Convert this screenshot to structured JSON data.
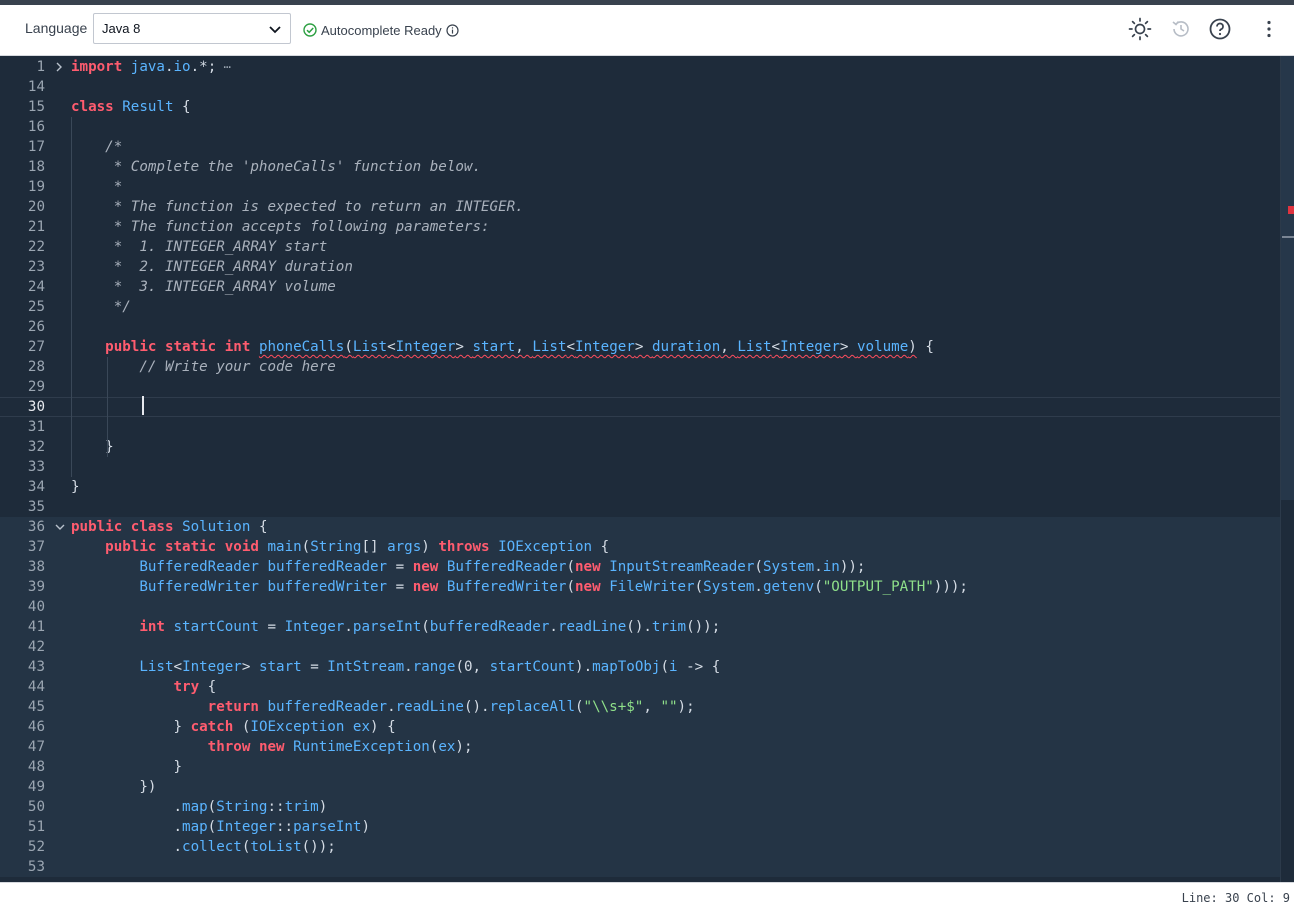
{
  "toolbar": {
    "language_label": "Language",
    "language_value": "Java 8",
    "autocomplete_status": "Autocomplete Ready",
    "icons": [
      "chevron-down-icon",
      "check-circle-icon",
      "info-icon",
      "sun-icon",
      "history-icon",
      "help-icon",
      "more-vertical-icon"
    ]
  },
  "editor": {
    "lines": [
      {
        "n": "1",
        "fold": "collapsed",
        "tokens": [
          [
            "kw",
            "import"
          ],
          [
            "pl",
            " "
          ],
          [
            "ty",
            "java"
          ],
          [
            "pl",
            "."
          ],
          [
            "ty",
            "io"
          ],
          [
            "pl",
            ".*;"
          ],
          [
            "ell",
            " ⋯"
          ]
        ]
      },
      {
        "n": "14",
        "tokens": []
      },
      {
        "n": "15",
        "tokens": [
          [
            "kw",
            "class"
          ],
          [
            "pl",
            " "
          ],
          [
            "ty",
            "Result"
          ],
          [
            "pl",
            " {"
          ]
        ]
      },
      {
        "n": "16",
        "tokens": []
      },
      {
        "n": "17",
        "tokens": [
          [
            "cm",
            "    /*"
          ]
        ]
      },
      {
        "n": "18",
        "tokens": [
          [
            "cm",
            "     * Complete the 'phoneCalls' function below."
          ]
        ]
      },
      {
        "n": "19",
        "tokens": [
          [
            "cm",
            "     *"
          ]
        ]
      },
      {
        "n": "20",
        "tokens": [
          [
            "cm",
            "     * The function is expected to return an INTEGER."
          ]
        ]
      },
      {
        "n": "21",
        "tokens": [
          [
            "cm",
            "     * The function accepts following parameters:"
          ]
        ]
      },
      {
        "n": "22",
        "tokens": [
          [
            "cm",
            "     *  1. INTEGER_ARRAY start"
          ]
        ]
      },
      {
        "n": "23",
        "tokens": [
          [
            "cm",
            "     *  2. INTEGER_ARRAY duration"
          ]
        ]
      },
      {
        "n": "24",
        "tokens": [
          [
            "cm",
            "     *  3. INTEGER_ARRAY volume"
          ]
        ]
      },
      {
        "n": "25",
        "tokens": [
          [
            "cm",
            "     */"
          ]
        ]
      },
      {
        "n": "26",
        "tokens": []
      },
      {
        "n": "27",
        "tokens": [
          [
            "pl",
            "    "
          ],
          [
            "kw",
            "public"
          ],
          [
            "pl",
            " "
          ],
          [
            "kw",
            "static"
          ],
          [
            "pl",
            " "
          ],
          [
            "kw",
            "int"
          ],
          [
            "pl",
            " "
          ],
          [
            "fnsq",
            "phoneCalls"
          ],
          [
            "plsq",
            "("
          ],
          [
            "tysq",
            "List"
          ],
          [
            "plsq",
            "<"
          ],
          [
            "tysq",
            "Integer"
          ],
          [
            "plsq",
            "> "
          ],
          [
            "tysq",
            "start"
          ],
          [
            "plsq",
            ", "
          ],
          [
            "tysq",
            "List"
          ],
          [
            "plsq",
            "<"
          ],
          [
            "tysq",
            "Integer"
          ],
          [
            "plsq",
            "> "
          ],
          [
            "tysq",
            "duration"
          ],
          [
            "plsq",
            ", "
          ],
          [
            "tysq",
            "List"
          ],
          [
            "plsq",
            "<"
          ],
          [
            "tysq",
            "Integer"
          ],
          [
            "plsq",
            "> "
          ],
          [
            "tysq",
            "volume"
          ],
          [
            "plsq",
            ")"
          ],
          [
            "pl",
            " {"
          ]
        ]
      },
      {
        "n": "28",
        "tokens": [
          [
            "cm",
            "        // Write your code here"
          ]
        ]
      },
      {
        "n": "29",
        "tokens": []
      },
      {
        "n": "30",
        "active": true,
        "tokens": []
      },
      {
        "n": "31",
        "tokens": []
      },
      {
        "n": "32",
        "tokens": [
          [
            "pl",
            "    }"
          ]
        ]
      },
      {
        "n": "33",
        "tokens": []
      },
      {
        "n": "34",
        "tokens": [
          [
            "pl",
            "}"
          ]
        ]
      },
      {
        "n": "35",
        "tokens": []
      },
      {
        "n": "36",
        "fold": "expanded",
        "hl": true,
        "tokens": [
          [
            "kw",
            "public"
          ],
          [
            "pl",
            " "
          ],
          [
            "kw",
            "class"
          ],
          [
            "pl",
            " "
          ],
          [
            "ty",
            "Solution"
          ],
          [
            "pl",
            " {"
          ]
        ]
      },
      {
        "n": "37",
        "hl": true,
        "tokens": [
          [
            "pl",
            "    "
          ],
          [
            "kw",
            "public"
          ],
          [
            "pl",
            " "
          ],
          [
            "kw",
            "static"
          ],
          [
            "pl",
            " "
          ],
          [
            "kw",
            "void"
          ],
          [
            "pl",
            " "
          ],
          [
            "fn",
            "main"
          ],
          [
            "pl",
            "("
          ],
          [
            "ty",
            "String"
          ],
          [
            "pl",
            "[] "
          ],
          [
            "ty",
            "args"
          ],
          [
            "pl",
            ") "
          ],
          [
            "kw",
            "throws"
          ],
          [
            "pl",
            " "
          ],
          [
            "ty",
            "IOException"
          ],
          [
            "pl",
            " {"
          ]
        ]
      },
      {
        "n": "38",
        "hl": true,
        "tokens": [
          [
            "pl",
            "        "
          ],
          [
            "ty",
            "BufferedReader"
          ],
          [
            "pl",
            " "
          ],
          [
            "ty",
            "bufferedReader"
          ],
          [
            "pl",
            " = "
          ],
          [
            "kw",
            "new"
          ],
          [
            "pl",
            " "
          ],
          [
            "ty",
            "BufferedReader"
          ],
          [
            "pl",
            "("
          ],
          [
            "kw",
            "new"
          ],
          [
            "pl",
            " "
          ],
          [
            "ty",
            "InputStreamReader"
          ],
          [
            "pl",
            "("
          ],
          [
            "ty",
            "System"
          ],
          [
            "pl",
            "."
          ],
          [
            "ty",
            "in"
          ],
          [
            "pl",
            "));"
          ]
        ]
      },
      {
        "n": "39",
        "hl": true,
        "tokens": [
          [
            "pl",
            "        "
          ],
          [
            "ty",
            "BufferedWriter"
          ],
          [
            "pl",
            " "
          ],
          [
            "ty",
            "bufferedWriter"
          ],
          [
            "pl",
            " = "
          ],
          [
            "kw",
            "new"
          ],
          [
            "pl",
            " "
          ],
          [
            "ty",
            "BufferedWriter"
          ],
          [
            "pl",
            "("
          ],
          [
            "kw",
            "new"
          ],
          [
            "pl",
            " "
          ],
          [
            "ty",
            "FileWriter"
          ],
          [
            "pl",
            "("
          ],
          [
            "ty",
            "System"
          ],
          [
            "pl",
            "."
          ],
          [
            "fn",
            "getenv"
          ],
          [
            "pl",
            "("
          ],
          [
            "st",
            "\"OUTPUT_PATH\""
          ],
          [
            "pl",
            ")));"
          ]
        ]
      },
      {
        "n": "40",
        "hl": true,
        "tokens": []
      },
      {
        "n": "41",
        "hl": true,
        "tokens": [
          [
            "pl",
            "        "
          ],
          [
            "kw",
            "int"
          ],
          [
            "pl",
            " "
          ],
          [
            "ty",
            "startCount"
          ],
          [
            "pl",
            " = "
          ],
          [
            "ty",
            "Integer"
          ],
          [
            "pl",
            "."
          ],
          [
            "fn",
            "parseInt"
          ],
          [
            "pl",
            "("
          ],
          [
            "ty",
            "bufferedReader"
          ],
          [
            "pl",
            "."
          ],
          [
            "fn",
            "readLine"
          ],
          [
            "pl",
            "()."
          ],
          [
            "fn",
            "trim"
          ],
          [
            "pl",
            "());"
          ]
        ]
      },
      {
        "n": "42",
        "hl": true,
        "tokens": []
      },
      {
        "n": "43",
        "hl": true,
        "tokens": [
          [
            "pl",
            "        "
          ],
          [
            "ty",
            "List"
          ],
          [
            "pl",
            "<"
          ],
          [
            "ty",
            "Integer"
          ],
          [
            "pl",
            "> "
          ],
          [
            "ty",
            "start"
          ],
          [
            "pl",
            " = "
          ],
          [
            "ty",
            "IntStream"
          ],
          [
            "pl",
            "."
          ],
          [
            "fn",
            "range"
          ],
          [
            "pl",
            "(0, "
          ],
          [
            "ty",
            "startCount"
          ],
          [
            "pl",
            ")."
          ],
          [
            "fn",
            "mapToObj"
          ],
          [
            "pl",
            "("
          ],
          [
            "ty",
            "i"
          ],
          [
            "pl",
            " -> {"
          ]
        ]
      },
      {
        "n": "44",
        "hl": true,
        "tokens": [
          [
            "pl",
            "            "
          ],
          [
            "kw",
            "try"
          ],
          [
            "pl",
            " {"
          ]
        ]
      },
      {
        "n": "45",
        "hl": true,
        "tokens": [
          [
            "pl",
            "                "
          ],
          [
            "kw",
            "return"
          ],
          [
            "pl",
            " "
          ],
          [
            "ty",
            "bufferedReader"
          ],
          [
            "pl",
            "."
          ],
          [
            "fn",
            "readLine"
          ],
          [
            "pl",
            "()."
          ],
          [
            "fn",
            "replaceAll"
          ],
          [
            "pl",
            "("
          ],
          [
            "st",
            "\"\\\\s+$\""
          ],
          [
            "pl",
            ", "
          ],
          [
            "st",
            "\"\""
          ],
          [
            "pl",
            ");"
          ]
        ]
      },
      {
        "n": "46",
        "hl": true,
        "tokens": [
          [
            "pl",
            "            } "
          ],
          [
            "kw",
            "catch"
          ],
          [
            "pl",
            " ("
          ],
          [
            "ty",
            "IOException"
          ],
          [
            "pl",
            " "
          ],
          [
            "ty",
            "ex"
          ],
          [
            "pl",
            ") {"
          ]
        ]
      },
      {
        "n": "47",
        "hl": true,
        "tokens": [
          [
            "pl",
            "                "
          ],
          [
            "kw",
            "throw"
          ],
          [
            "pl",
            " "
          ],
          [
            "kw",
            "new"
          ],
          [
            "pl",
            " "
          ],
          [
            "ty",
            "RuntimeException"
          ],
          [
            "pl",
            "("
          ],
          [
            "ty",
            "ex"
          ],
          [
            "pl",
            ");"
          ]
        ]
      },
      {
        "n": "48",
        "hl": true,
        "tokens": [
          [
            "pl",
            "            }"
          ]
        ]
      },
      {
        "n": "49",
        "hl": true,
        "tokens": [
          [
            "pl",
            "        })"
          ]
        ]
      },
      {
        "n": "50",
        "hl": true,
        "tokens": [
          [
            "pl",
            "            ."
          ],
          [
            "fn",
            "map"
          ],
          [
            "pl",
            "("
          ],
          [
            "ty",
            "String"
          ],
          [
            "pl",
            "::"
          ],
          [
            "fn",
            "trim"
          ],
          [
            "pl",
            ")"
          ]
        ]
      },
      {
        "n": "51",
        "hl": true,
        "tokens": [
          [
            "pl",
            "            ."
          ],
          [
            "fn",
            "map"
          ],
          [
            "pl",
            "("
          ],
          [
            "ty",
            "Integer"
          ],
          [
            "pl",
            "::"
          ],
          [
            "fn",
            "parseInt"
          ],
          [
            "pl",
            ")"
          ]
        ]
      },
      {
        "n": "52",
        "hl": true,
        "tokens": [
          [
            "pl",
            "            ."
          ],
          [
            "fn",
            "collect"
          ],
          [
            "pl",
            "("
          ],
          [
            "fn",
            "toList"
          ],
          [
            "pl",
            "());"
          ]
        ]
      },
      {
        "n": "53",
        "hl": true,
        "tokens": []
      }
    ]
  },
  "status": {
    "position": "Line: 30 Col: 9"
  }
}
